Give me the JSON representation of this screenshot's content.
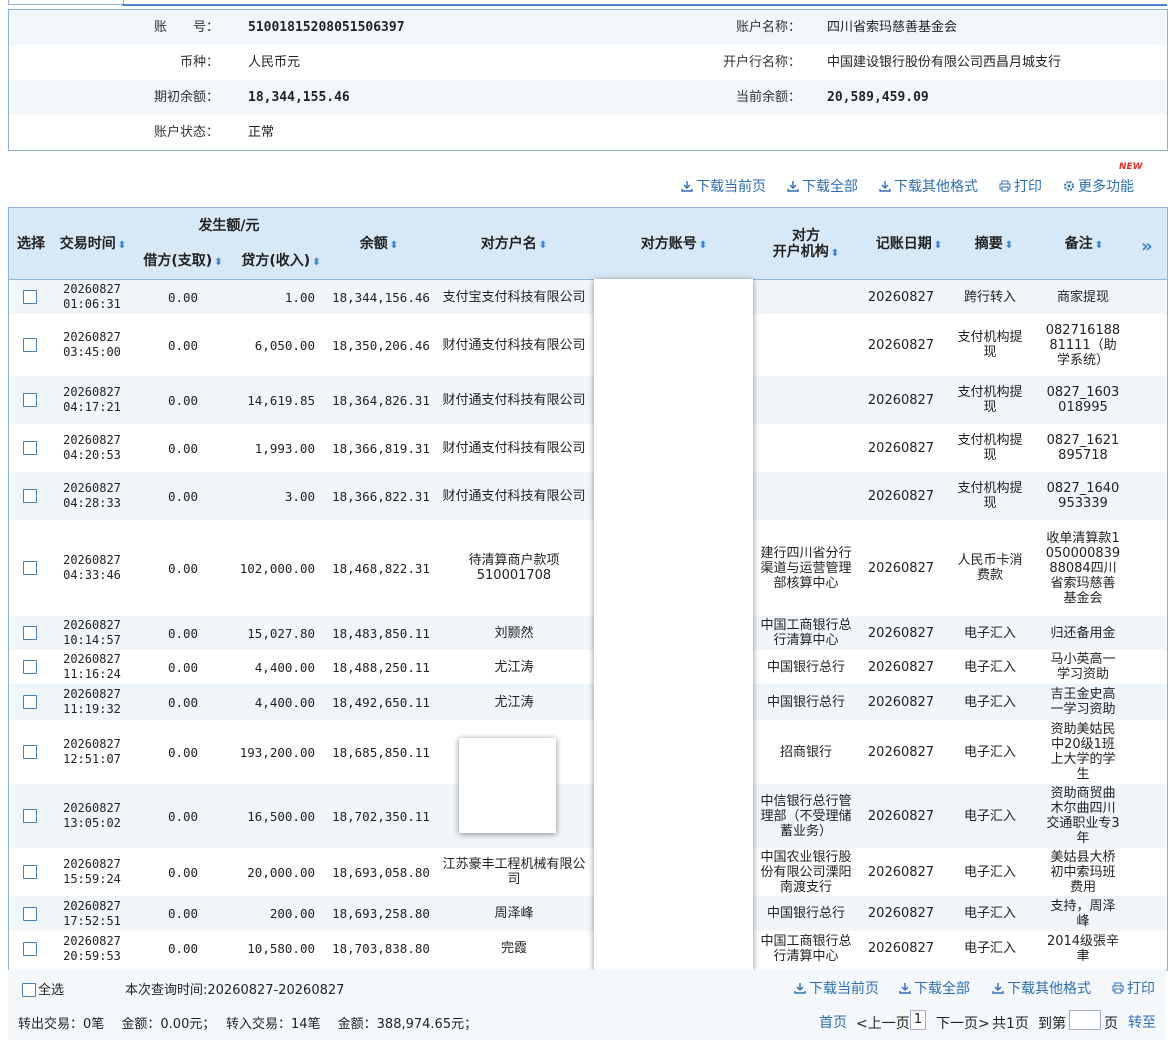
{
  "account": {
    "account_no_label": "账　　号：",
    "account_no": "51001815208051506397",
    "account_name_label": "账户名称：",
    "account_name": "四川省索玛慈善基金会",
    "currency_label": "币种：",
    "currency": "人民币元",
    "bank_label": "开户行名称：",
    "bank": "中国建设银行股份有限公司西昌月城支行",
    "opening_label": "期初余额：",
    "opening_balance": "18,344,155.46",
    "current_label": "当前余额：",
    "current_balance": "20,589,459.09",
    "status_label": "账户状态：",
    "status": "正常"
  },
  "actions": {
    "download_page": "下载当前页",
    "download_all": "下载全部",
    "download_other": "下载其他格式",
    "print": "打印",
    "more": "更多功能",
    "new_badge": "NEW"
  },
  "table": {
    "headers": {
      "select": "选择",
      "time": "交易时间",
      "amount_group": "发生额/元",
      "debit": "借方(支取)",
      "credit": "贷方(收入)",
      "balance": "余额",
      "party_name": "对方户名",
      "party_account": "对方账号",
      "party_bank_1": "对方",
      "party_bank_2": "开户机构",
      "post_date": "记账日期",
      "summary": "摘要",
      "note": "备注",
      "more": "»"
    },
    "rows": [
      {
        "date": "20260827",
        "time": "01:06:31",
        "debit": "0.00",
        "credit": "1.00",
        "balance": "18,344,156.46",
        "party": "支付宝支付科技有限公司",
        "bank": "",
        "post": "20260827",
        "summary": "跨行转入",
        "note": "商家提现"
      },
      {
        "date": "20260827",
        "time": "03:45:00",
        "debit": "0.00",
        "credit": "6,050.00",
        "balance": "18,350,206.46",
        "party": "财付通支付科技有限公司",
        "bank": "",
        "post": "20260827",
        "summary": "支付机构提现",
        "note": "08271618881111（助学系统）"
      },
      {
        "date": "20260827",
        "time": "04:17:21",
        "debit": "0.00",
        "credit": "14,619.85",
        "balance": "18,364,826.31",
        "party": "财付通支付科技有限公司",
        "bank": "",
        "post": "20260827",
        "summary": "支付机构提现",
        "note": "0827_1603018995"
      },
      {
        "date": "20260827",
        "time": "04:20:53",
        "debit": "0.00",
        "credit": "1,993.00",
        "balance": "18,366,819.31",
        "party": "财付通支付科技有限公司",
        "bank": "",
        "post": "20260827",
        "summary": "支付机构提现",
        "note": "0827_1621895718"
      },
      {
        "date": "20260827",
        "time": "04:28:33",
        "debit": "0.00",
        "credit": "3.00",
        "balance": "18,366,822.31",
        "party": "财付通支付科技有限公司",
        "bank": "",
        "post": "20260827",
        "summary": "支付机构提现",
        "note": "0827_1640953339"
      },
      {
        "date": "20260827",
        "time": "04:33:46",
        "debit": "0.00",
        "credit": "102,000.00",
        "balance": "18,468,822.31",
        "party": "待清算商户款项510001708",
        "bank": "建行四川省分行渠道与运营管理部核算中心",
        "post": "20260827",
        "summary": "人民币卡消费款",
        "note": "收单清算款105000083988084四川省索玛慈善基金会"
      },
      {
        "date": "20260827",
        "time": "10:14:57",
        "debit": "0.00",
        "credit": "15,027.80",
        "balance": "18,483,850.11",
        "party": "刘颢然",
        "bank": "中国工商银行总行清算中心",
        "post": "20260827",
        "summary": "电子汇入",
        "note": "归还备用金"
      },
      {
        "date": "20260827",
        "time": "11:16:24",
        "debit": "0.00",
        "credit": "4,400.00",
        "balance": "18,488,250.11",
        "party": "尤江涛",
        "bank": "中国银行总行",
        "post": "20260827",
        "summary": "电子汇入",
        "note": "马小英高一学习资助"
      },
      {
        "date": "20260827",
        "time": "11:19:32",
        "debit": "0.00",
        "credit": "4,400.00",
        "balance": "18,492,650.11",
        "party": "尤江涛",
        "bank": "中国银行总行",
        "post": "20260827",
        "summary": "电子汇入",
        "note": "吉王金史高一学习资助"
      },
      {
        "date": "20260827",
        "time": "12:51:07",
        "debit": "0.00",
        "credit": "193,200.00",
        "balance": "18,685,850.11",
        "party": "",
        "bank": "招商银行",
        "post": "20260827",
        "summary": "电子汇入",
        "note": "资助美姑民中20级1班上大学的学生"
      },
      {
        "date": "20260827",
        "time": "13:05:02",
        "debit": "0.00",
        "credit": "16,500.00",
        "balance": "18,702,350.11",
        "party": "",
        "bank": "中信银行总行管理部（不受理储蓄业务）",
        "post": "20260827",
        "summary": "电子汇入",
        "note": "资助商贸曲木尔曲四川交通职业专3年"
      },
      {
        "date": "20260827",
        "time": "15:59:24",
        "debit": "0.00",
        "credit": "20,000.00",
        "balance": "18,693,058.80",
        "party": "江苏豪丰工程机械有限公司",
        "bank": "中国农业银行股份有限公司溧阳南渡支行",
        "post": "20260827",
        "summary": "电子汇入",
        "note": "美姑县大桥初中索玛班费用"
      },
      {
        "date": "20260827",
        "time": "17:52:51",
        "debit": "0.00",
        "credit": "200.00",
        "balance": "18,693,258.80",
        "party": "周泽峰",
        "bank": "中国银行总行",
        "post": "20260827",
        "summary": "电子汇入",
        "note": "支持，周泽峰"
      },
      {
        "date": "20260827",
        "time": "20:59:53",
        "debit": "0.00",
        "credit": "10,580.00",
        "balance": "18,703,838.80",
        "party": "完霞",
        "bank": "中国工商银行总行清算中心",
        "post": "20260827",
        "summary": "电子汇入",
        "note": "2014级張辛聿"
      }
    ]
  },
  "footer": {
    "select_all": "全选",
    "query_time": "本次查询时间:20260827-20260827",
    "download_page": "下载当前页",
    "download_all": "下载全部",
    "download_other": "下载其他格式",
    "print": "打印",
    "summary_text": "转出交易：0笔　 金额：0.00元；　 转入交易：14笔　 金额：388,974.65元；",
    "first": "首页",
    "prev": "<上一页",
    "page_current": "1",
    "next": "下一页>",
    "total": "共1页",
    "goto_prefix": "到第",
    "goto_suffix": "页",
    "goto_btn": "转至"
  },
  "colors": {
    "accent": "#2e6fb4",
    "header_bg": "#d7e8f7",
    "border": "#8db3d6",
    "new_badge": "#e0302a"
  },
  "icons": [
    "download-icon",
    "print-icon",
    "gear-icon",
    "sort-icon",
    "more-columns-icon"
  ]
}
